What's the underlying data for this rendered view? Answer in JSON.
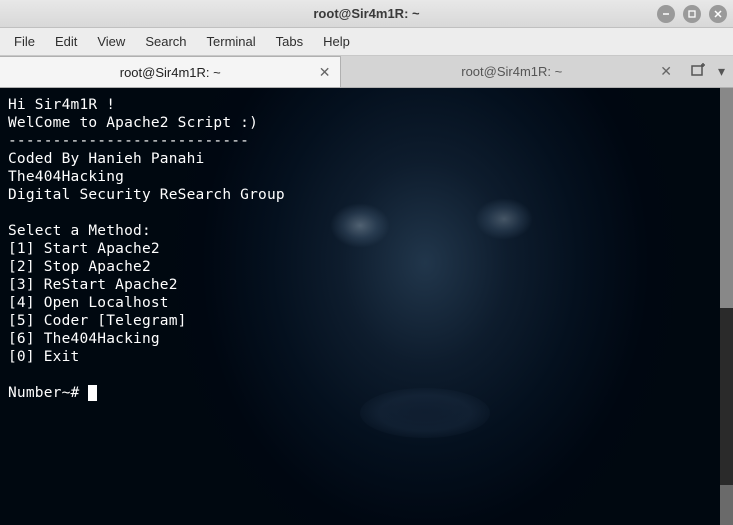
{
  "window": {
    "title": "root@Sir4m1R: ~"
  },
  "menubar": {
    "items": [
      "File",
      "Edit",
      "View",
      "Search",
      "Terminal",
      "Tabs",
      "Help"
    ]
  },
  "tabs": [
    {
      "label": "root@Sir4m1R: ~",
      "active": true
    },
    {
      "label": "root@Sir4m1R: ~",
      "active": false
    }
  ],
  "terminal": {
    "lines": [
      "Hi Sir4m1R !",
      "WelCome to Apache2 Script :)",
      "---------------------------",
      "Coded By Hanieh Panahi",
      "The404Hacking",
      "Digital Security ReSearch Group",
      "",
      "Select a Method:",
      "[1] Start Apache2",
      "[2] Stop Apache2",
      "[3] ReStart Apache2",
      "[4] Open Localhost",
      "[5] Coder [Telegram]",
      "[6] The404Hacking",
      "[0] Exit",
      "",
      "Number~# "
    ]
  }
}
